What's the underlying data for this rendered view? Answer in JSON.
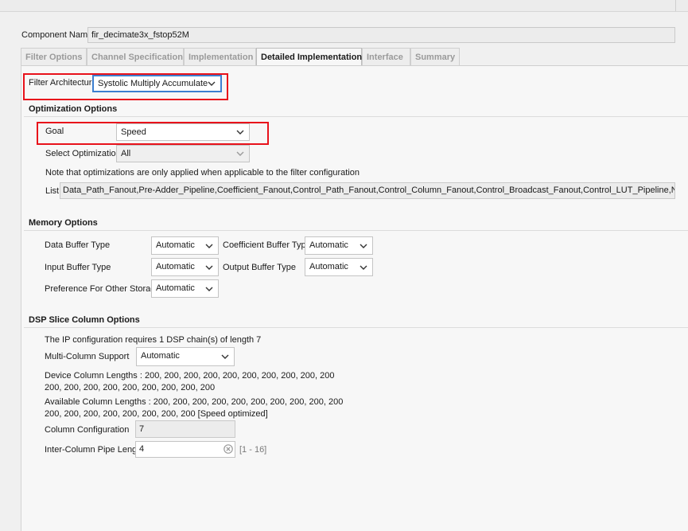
{
  "component": {
    "label": "Component Name",
    "value": "fir_decimate3x_fstop52M"
  },
  "tabs": [
    {
      "label": "Filter Options",
      "active": false
    },
    {
      "label": "Channel Specification",
      "active": false
    },
    {
      "label": "Implementation",
      "active": false
    },
    {
      "label": "Detailed Implementation",
      "active": true
    },
    {
      "label": "Interface",
      "active": false
    },
    {
      "label": "Summary",
      "active": false
    }
  ],
  "filter_architecture": {
    "label": "Filter Architecture",
    "value": "Systolic Multiply Accumulate"
  },
  "optimization": {
    "title": "Optimization Options",
    "goal_label": "Goal",
    "goal_value": "Speed",
    "select_label": "Select Optimization",
    "select_value": "All",
    "note": "Note that optimizations are only applied when applicable to the filter configuration",
    "list_label": "List",
    "list_value": "Data_Path_Fanout,Pre-Adder_Pipeline,Coefficient_Fanout,Control_Path_Fanout,Control_Column_Fanout,Control_Broadcast_Fanout,Control_LUT_Pipeline,No_BRAM_Read_Fir"
  },
  "memory": {
    "title": "Memory Options",
    "data_buffer_label": "Data Buffer Type",
    "data_buffer_value": "Automatic",
    "coef_buffer_label": "Coefficient Buffer Type",
    "coef_buffer_value": "Automatic",
    "input_buffer_label": "Input Buffer Type",
    "input_buffer_value": "Automatic",
    "output_buffer_label": "Output Buffer Type",
    "output_buffer_value": "Automatic",
    "pref_label": "Preference For Other Storage",
    "pref_value": "Automatic"
  },
  "dsp": {
    "title": "DSP Slice Column Options",
    "requires_text": "The IP configuration requires 1 DSP chain(s) of length 7",
    "multi_label": "Multi-Column Support",
    "multi_value": "Automatic",
    "device_line1": "Device Column Lengths : 200, 200, 200, 200, 200, 200, 200, 200, 200, 200",
    "device_line2": "200, 200, 200, 200, 200, 200, 200, 200, 200",
    "available_line1": "Available Column Lengths : 200, 200, 200, 200, 200, 200, 200, 200, 200, 200",
    "available_line2": "200, 200, 200, 200, 200, 200, 200, 200 [Speed optimized]",
    "column_config_label": "Column Configuration",
    "column_config_value": "7",
    "pipe_label": "Inter-Column Pipe Length",
    "pipe_value": "4",
    "pipe_range": "[1 - 16]"
  },
  "colors": {
    "highlight": "#e8121b",
    "focus": "#3c7fd0"
  }
}
